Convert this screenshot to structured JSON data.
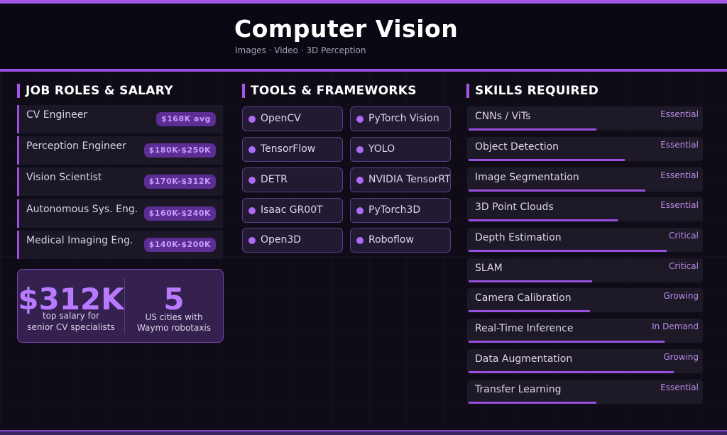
{
  "header": {
    "title": "Computer Vision",
    "subtitle": "Images · Video · 3D Perception"
  },
  "sections": {
    "roles_title": "JOB ROLES & SALARY",
    "tools_title": "TOOLS & FRAMEWORKS",
    "skills_title": "SKILLS REQUIRED"
  },
  "roles": [
    {
      "name": "CV Engineer",
      "salary": "$168K avg"
    },
    {
      "name": "Perception Engineer",
      "salary": "$180K-$250K"
    },
    {
      "name": "Vision Scientist",
      "salary": "$170K-$312K"
    },
    {
      "name": "Autonomous Sys. Eng.",
      "salary": "$160K-$240K"
    },
    {
      "name": "Medical Imaging Eng.",
      "salary": "$140K-$200K"
    }
  ],
  "stats": [
    {
      "value": "$312K",
      "label_line1": "top salary for",
      "label_line2": "senior CV specialists"
    },
    {
      "value": "5",
      "label_line1": "US cities with",
      "label_line2": "Waymo robotaxis"
    }
  ],
  "tools": [
    {
      "label": "OpenCV"
    },
    {
      "label": "PyTorch Vision"
    },
    {
      "label": "TensorFlow"
    },
    {
      "label": "YOLO"
    },
    {
      "label": "DETR"
    },
    {
      "label": "NVIDIA TensorRT"
    },
    {
      "label": "Isaac GR00T"
    },
    {
      "label": "PyTorch3D"
    },
    {
      "label": "Open3D"
    },
    {
      "label": "Roboflow"
    }
  ],
  "skills": [
    {
      "name": "CNNs / ViTs",
      "level": "Essential",
      "proficiency": 0.55
    },
    {
      "name": "Object Detection",
      "level": "Essential",
      "proficiency": 0.67
    },
    {
      "name": "Image Segmentation",
      "level": "Essential",
      "proficiency": 0.76
    },
    {
      "name": "3D Point Clouds",
      "level": "Essential",
      "proficiency": 0.64
    },
    {
      "name": "Depth Estimation",
      "level": "Critical",
      "proficiency": 0.85
    },
    {
      "name": "SLAM",
      "level": "Critical",
      "proficiency": 0.53
    },
    {
      "name": "Camera Calibration",
      "level": "Growing",
      "proficiency": 0.52
    },
    {
      "name": "Real-Time Inference",
      "level": "In Demand",
      "proficiency": 0.84
    },
    {
      "name": "Data Augmentation",
      "level": "Growing",
      "proficiency": 0.88
    },
    {
      "name": "Transfer Learning",
      "level": "Essential",
      "proficiency": 0.55
    }
  ],
  "colors": {
    "accent": "#a356e8",
    "background": "#0f0c18",
    "badge": "#5c2e93",
    "stat_value": "#b87bff"
  }
}
